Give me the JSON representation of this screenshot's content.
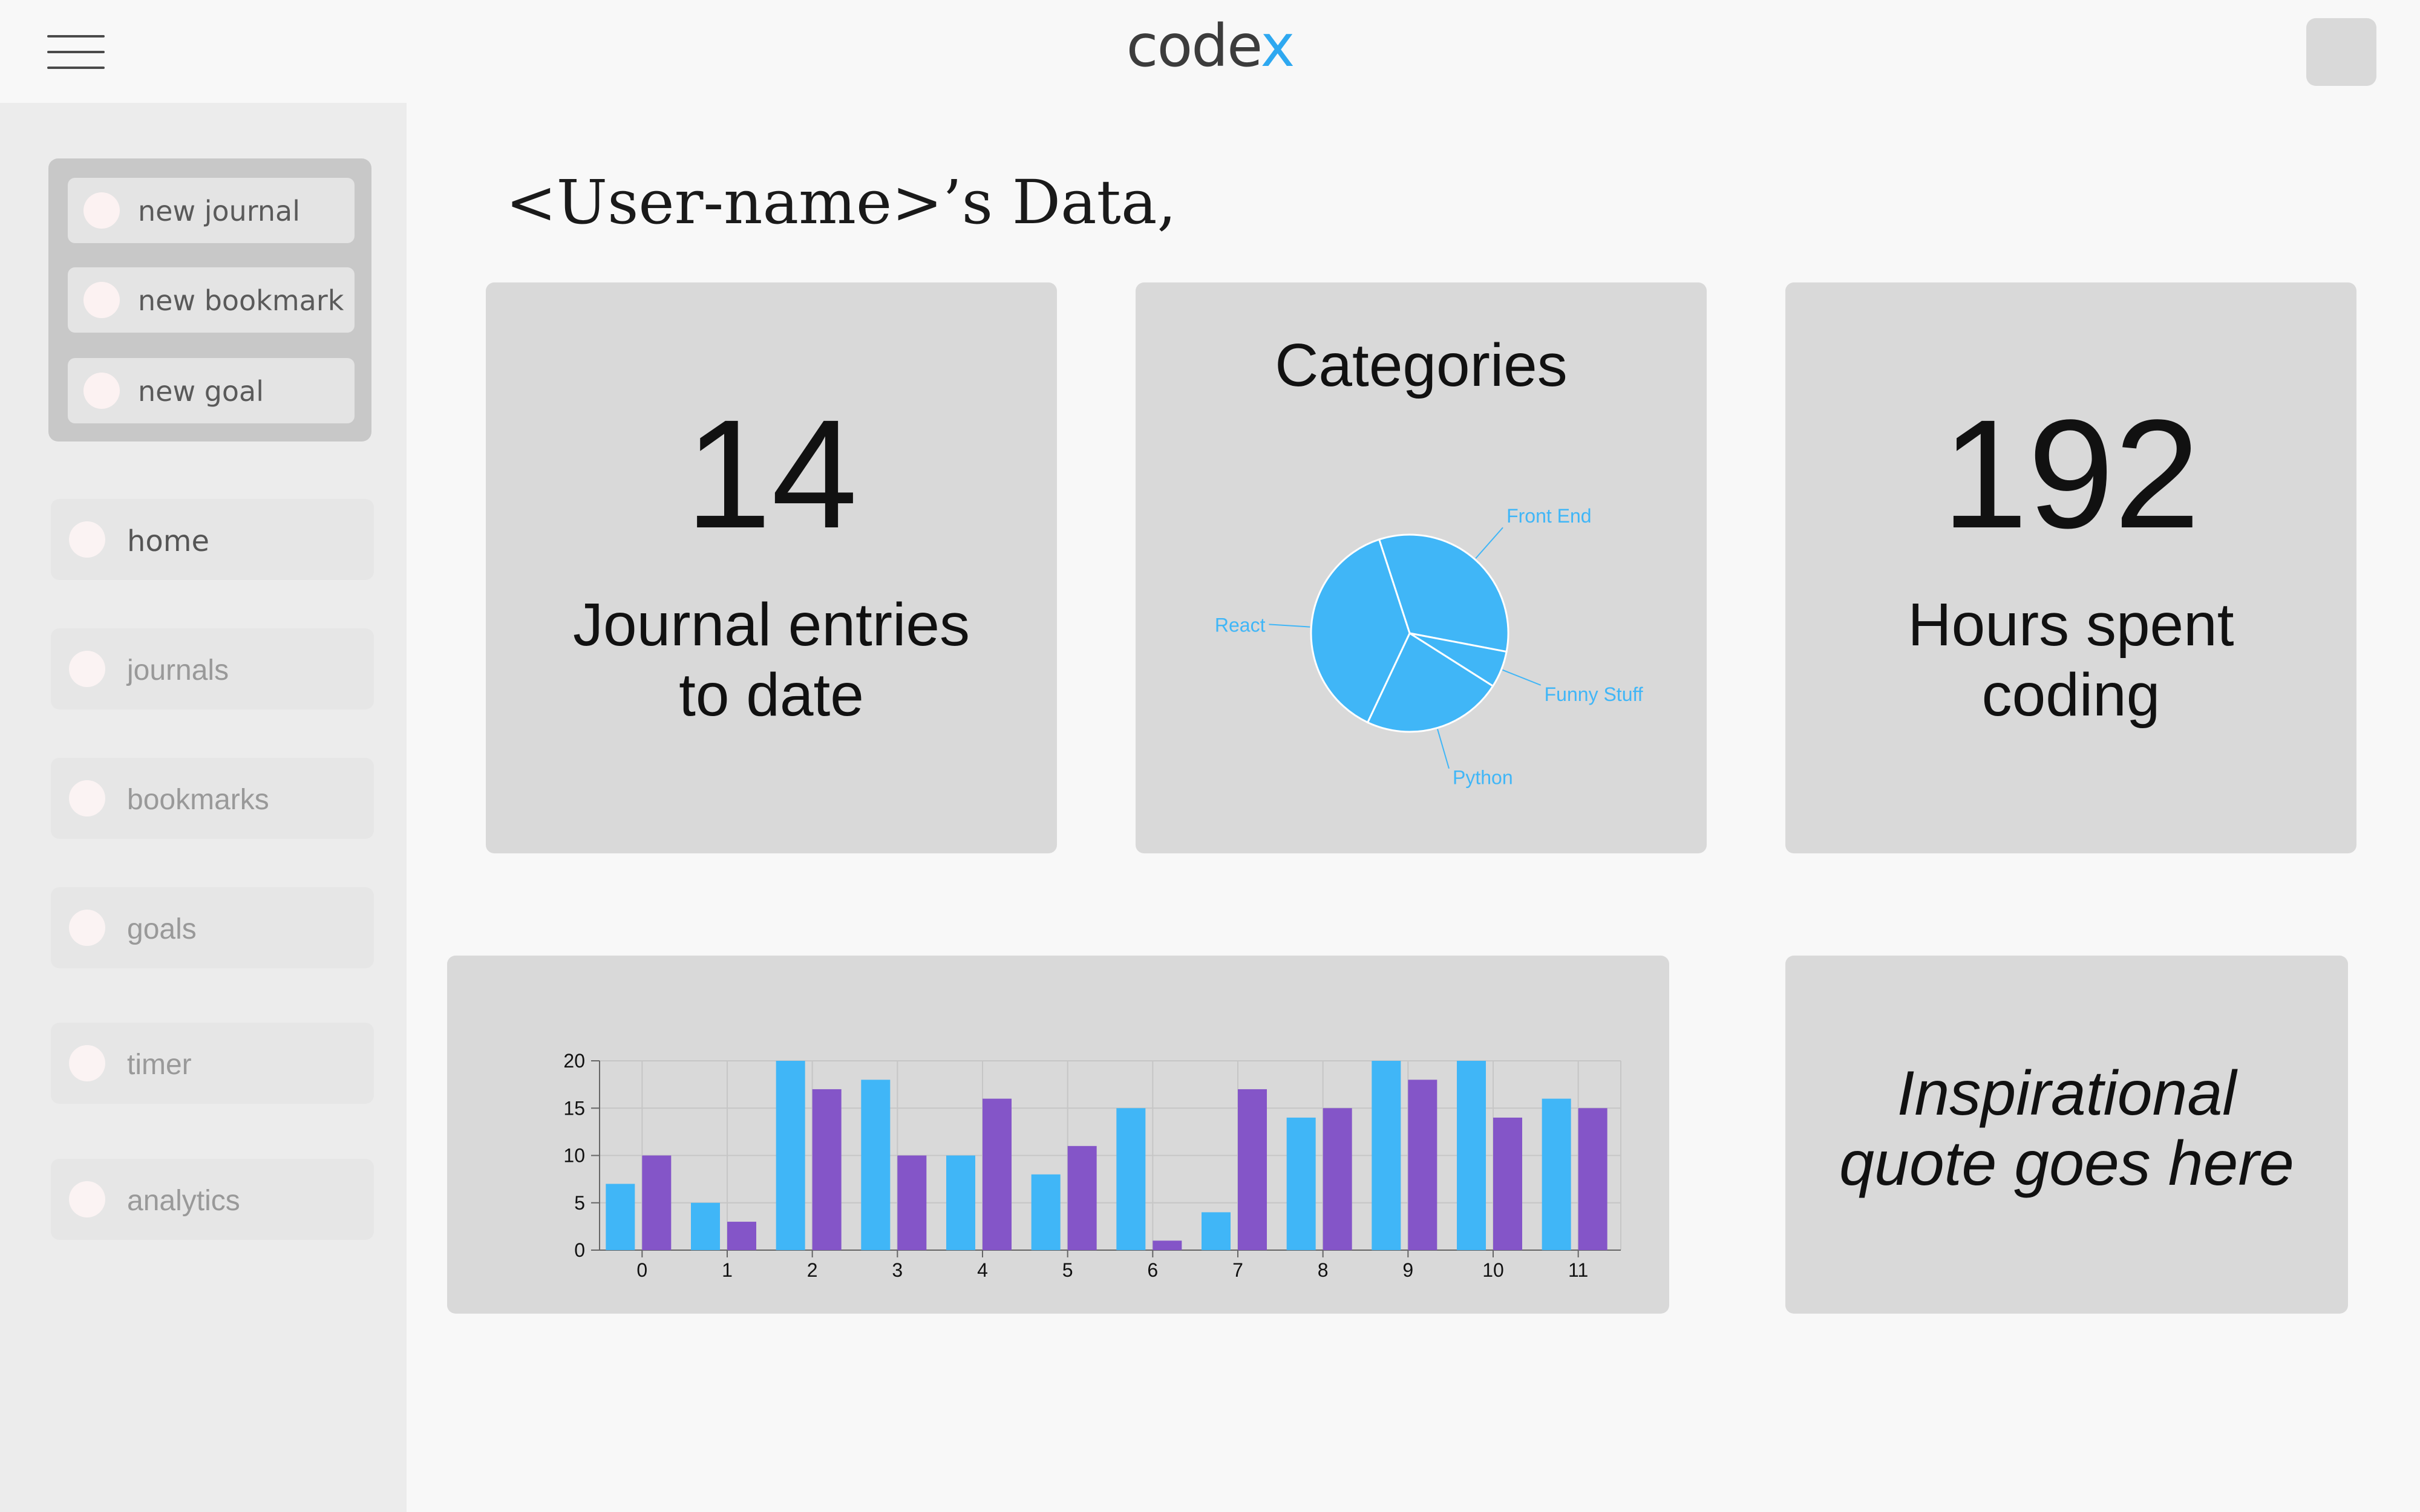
{
  "header": {
    "logo_main": "code",
    "logo_accent": "x"
  },
  "quick_actions": [
    {
      "label": "new journal"
    },
    {
      "label": "new bookmark"
    },
    {
      "label": "new goal"
    }
  ],
  "nav": [
    {
      "label": "home",
      "active": true
    },
    {
      "label": "journals"
    },
    {
      "label": "bookmarks"
    },
    {
      "label": "goals"
    },
    {
      "label": "timer"
    },
    {
      "label": "analytics"
    }
  ],
  "page": {
    "heading": "<User-name>’s Data,"
  },
  "stats": {
    "journal_count": "14",
    "journal_label_1": "Journal entries",
    "journal_label_2": "to date",
    "hours_count": "192",
    "hours_label_1": "Hours spent",
    "hours_label_2": "coding"
  },
  "categories_card": {
    "title": "Categories"
  },
  "quote": {
    "line1": "Inspirational",
    "line2": "quote goes here"
  },
  "colors": {
    "accent": "#2ea8f0",
    "pie": "#40b6f7",
    "bar_a": "#40b6f7",
    "bar_b": "#8455c8",
    "card": "#d9d9d9"
  },
  "chart_data": [
    {
      "type": "pie",
      "labels": [
        "Front End",
        "Funny Stuff",
        "Python",
        "React"
      ],
      "values": [
        33,
        6,
        23,
        38
      ]
    },
    {
      "type": "bar",
      "categories": [
        "0",
        "1",
        "2",
        "3",
        "4",
        "5",
        "6",
        "7",
        "8",
        "9",
        "10",
        "11"
      ],
      "series": [
        {
          "values": [
            7,
            5,
            20,
            18,
            10,
            8,
            15,
            4,
            14,
            20,
            20,
            16
          ]
        },
        {
          "values": [
            10,
            3,
            17,
            10,
            16,
            11,
            1,
            17,
            15,
            18,
            14,
            15
          ]
        }
      ],
      "ylim": [
        0,
        20
      ],
      "yticks": [
        0,
        5,
        10,
        15,
        20
      ],
      "grid": true
    }
  ]
}
